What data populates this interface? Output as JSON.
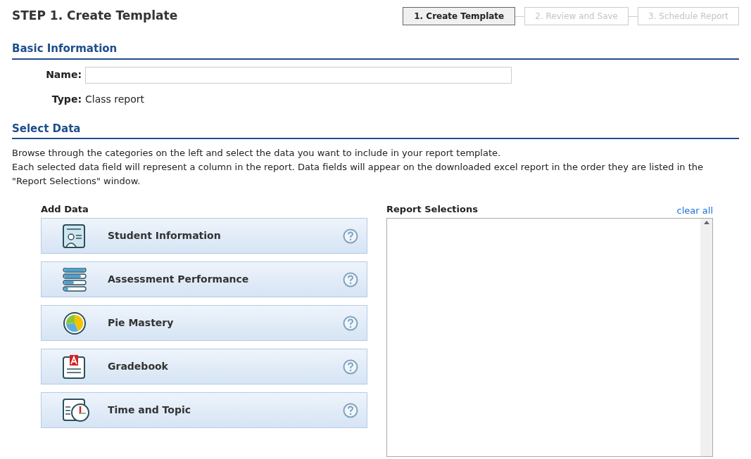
{
  "title": "STEP 1. Create Template",
  "steps": [
    {
      "label": "1. Create Template",
      "selected": true
    },
    {
      "label": "2. Review and Save",
      "selected": false
    },
    {
      "label": "3. Schedule Report",
      "selected": false
    }
  ],
  "basic_info": {
    "heading": "Basic Information",
    "name_label": "Name:",
    "type_label": "Type:",
    "type_value": "Class report"
  },
  "select_data": {
    "heading": "Select Data",
    "description": [
      "Browse through the categories on the left and select the data you want to include in your report template.",
      "Each selected data field will represent a column in the report. Data fields will appear on the downloaded excel report in the order they are listed in the \"Report Selections\" window."
    ]
  },
  "add_data": {
    "heading": "Add Data",
    "categories": [
      {
        "label": "Student Information",
        "kind": "student"
      },
      {
        "label": "Assessment Performance",
        "kind": "assessment"
      },
      {
        "label": "Pie Mastery",
        "kind": "pie"
      },
      {
        "label": "Gradebook",
        "kind": "gradebook"
      },
      {
        "label": "Time and Topic",
        "kind": "time"
      }
    ]
  },
  "report_selections": {
    "heading": "Report Selections",
    "clear_link": "clear all"
  }
}
